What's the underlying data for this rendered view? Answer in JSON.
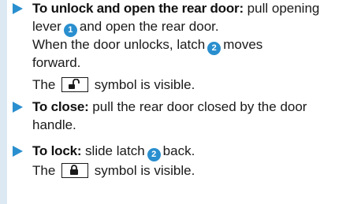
{
  "items": [
    {
      "lead": "To unlock and open the rear door:",
      "l1_rest": "pull opening",
      "l2_pre": "lever",
      "l2_marker": "1",
      "l2_post": "and open the rear door.",
      "l3_pre": "When the door unlocks, latch",
      "l3_marker": "2",
      "l3_post": "moves",
      "l4": "forward.",
      "note_pre": "The",
      "note_symbol": "unlocked-padlock-icon",
      "note_post": "symbol is visible."
    },
    {
      "lead": "To close:",
      "l1_rest": "pull the rear door closed by the door",
      "l2": "handle."
    },
    {
      "lead": "To lock:",
      "l1_pre": "slide latch",
      "l1_marker": "2",
      "l1_post": "back.",
      "note_pre": "The",
      "note_symbol": "locked-padlock-icon",
      "note_post": "symbol is visible."
    }
  ],
  "colors": {
    "accent": "#2a8fcf",
    "sidebar": "#dce9f2",
    "text": "#1a1a1a"
  }
}
